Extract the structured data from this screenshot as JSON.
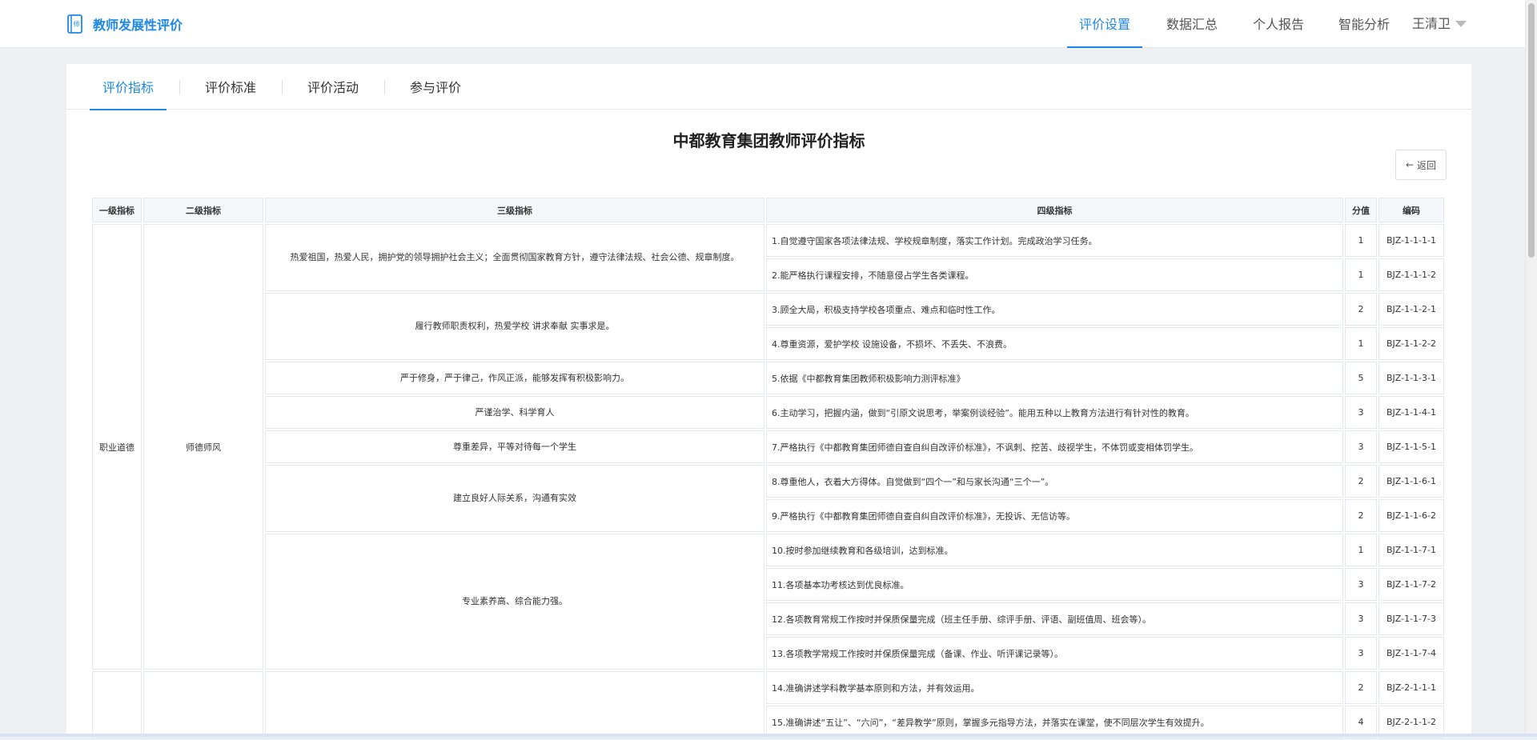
{
  "app": {
    "title": "教师发展性评价",
    "brand_icon_char": "师"
  },
  "nav": {
    "items": [
      {
        "label": "评价设置",
        "active": true
      },
      {
        "label": "数据汇总",
        "active": false
      },
      {
        "label": "个人报告",
        "active": false
      },
      {
        "label": "智能分析",
        "active": false
      }
    ],
    "user": "王清卫"
  },
  "tabs": [
    {
      "label": "评价指标",
      "active": true
    },
    {
      "label": "评价标准",
      "active": false
    },
    {
      "label": "评价活动",
      "active": false
    },
    {
      "label": "参与评价",
      "active": false
    }
  ],
  "page": {
    "title": "中都教育集团教师评价指标",
    "back_label": "返回"
  },
  "table": {
    "headers": [
      "一级指标",
      "二级指标",
      "三级指标",
      "四级指标",
      "分值",
      "编码"
    ],
    "level1": "职业道德",
    "level2": "师德师风",
    "level3": [
      "热爱祖国，热爱人民，拥护党的领导拥护社会主义；全面贯彻国家教育方针，遵守法律法规、社会公德、规章制度。",
      "履行教师职责权利，热爱学校 讲求奉献 实事求是。",
      "严于修身，严于律己，作风正派，能够发挥有积极影响力。",
      "严谨治学、科学育人",
      "尊重差异，平等对待每一个学生",
      "建立良好人际关系，沟通有实效",
      "专业素养高、综合能力强。"
    ],
    "rows": [
      {
        "text": "1.自觉遵守国家各项法律法规、学校规章制度，落实工作计划。完成政治学习任务。",
        "score": "1",
        "code": "BJZ-1-1-1-1"
      },
      {
        "text": "2.能严格执行课程安排，不随意侵占学生各类课程。",
        "score": "1",
        "code": "BJZ-1-1-1-2"
      },
      {
        "text": "3.顾全大局，积极支持学校各项重点、难点和临时性工作。",
        "score": "2",
        "code": "BJZ-1-1-2-1"
      },
      {
        "text": "4.尊重资源，爱护学校 设施设备，不损坏、不丢失、不浪费。",
        "score": "1",
        "code": "BJZ-1-1-2-2"
      },
      {
        "text": "5.依据《中都教育集团教师积极影响力测评标准》",
        "score": "5",
        "code": "BJZ-1-1-3-1"
      },
      {
        "text": "6.主动学习，把握内涵，做到“引原文说思考，举案例谈经验”。能用五种以上教育方法进行有针对性的教育。",
        "score": "3",
        "code": "BJZ-1-1-4-1"
      },
      {
        "text": "7.严格执行《中都教育集团师德自查自纠自改评价标准》，不讽刺、挖苦、歧视学生，不体罚或变相体罚学生。",
        "score": "3",
        "code": "BJZ-1-1-5-1"
      },
      {
        "text": "8.尊重他人，衣着大方得体。自觉做到“四个一”和与家长沟通“三个一”。",
        "score": "2",
        "code": "BJZ-1-1-6-1"
      },
      {
        "text": "9.严格执行《中都教育集团师德自查自纠自改评价标准》，无投诉、无信访等。",
        "score": "2",
        "code": "BJZ-1-1-6-2"
      },
      {
        "text": "10.按时参加继续教育和各级培训，达到标准。",
        "score": "1",
        "code": "BJZ-1-1-7-1"
      },
      {
        "text": "11.各项基本功考核达到优良标准。",
        "score": "3",
        "code": "BJZ-1-1-7-2"
      },
      {
        "text": "12.各项教育常规工作按时并保质保量完成（班主任手册、综评手册、评语、副班值周、班会等）。",
        "score": "3",
        "code": "BJZ-1-1-7-3"
      },
      {
        "text": "13.各项教学常规工作按时并保质保量完成（备课、作业、听评课记录等）。",
        "score": "3",
        "code": "BJZ-1-1-7-4"
      },
      {
        "text": "14.准确讲述学科教学基本原则和方法，并有效运用。",
        "score": "2",
        "code": "BJZ-2-1-1-1"
      },
      {
        "text": "15.准确讲述“五让”、“六问”，“差异教学”原则，掌握多元指导方法，并落实在课堂，使不同层次学生有效提升。",
        "score": "4",
        "code": "BJZ-2-1-1-2"
      }
    ]
  },
  "colors": {
    "accent": "#1e88e5",
    "header_bg": "#f5f7fa",
    "border": "#e4e7ed",
    "page_bg": "#eef0f3"
  }
}
